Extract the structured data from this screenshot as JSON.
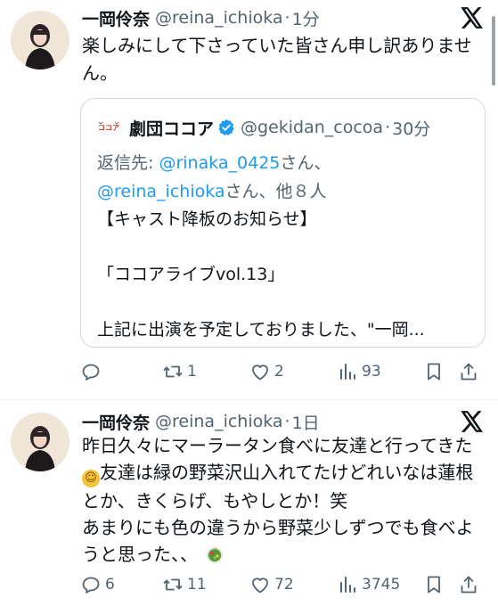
{
  "tweets": [
    {
      "name": "一岡伶奈",
      "handle": "@reina_ichioka",
      "sep": "·",
      "time": "1分",
      "text": "楽しみにして下さっていた皆さん申し訳ありません。",
      "quote": {
        "name": "劇団ココア",
        "handle": "@gekidan_cocoa",
        "sep": "·",
        "time": "30分",
        "reply_prefix": "返信先: ",
        "reply_mention_1": "@rinaka_0425",
        "reply_mid": "さん、",
        "reply_mention_2": "@reina_ichioka",
        "reply_suffix": "さん、他８人",
        "body": [
          "【キャスト降板のお知らせ】",
          "",
          "「ココアライブvol.13」",
          "",
          "上記に出演を予定しておりました、\"一岡..."
        ]
      },
      "actions": {
        "replies": "",
        "retweets": "1",
        "likes": "2",
        "views": "93"
      }
    },
    {
      "name": "一岡伶奈",
      "handle": "@reina_ichioka",
      "sep": "·",
      "time": "1日",
      "text_before_emoji": "昨日久々にマーラータン食べに友達と行ってきた",
      "inline_emoji": "☺",
      "text_after_emoji": "友達は緑の野菜沢山入れてたけどれいなは蓮根とか、きくらげ、もやしとか！笑\nあまりにも色の違うから野菜少しずつでも食べようと思った、、",
      "actions": {
        "replies": "6",
        "retweets": "11",
        "likes": "72",
        "views": "3745"
      }
    }
  ],
  "colors": {
    "text": "#0f1419",
    "secondary": "#536471",
    "link": "#1d9bf0",
    "border": "#cfd9de",
    "verified": "#1d9bf0"
  },
  "icons": {
    "x_logo": "x-logo-icon",
    "reply": "reply-icon",
    "retweet": "retweet-icon",
    "like": "heart-icon",
    "views": "views-icon",
    "bookmark": "bookmark-icon",
    "share": "share-icon",
    "verified": "verified-badge-icon",
    "salad": "salad-emoji-icon"
  }
}
